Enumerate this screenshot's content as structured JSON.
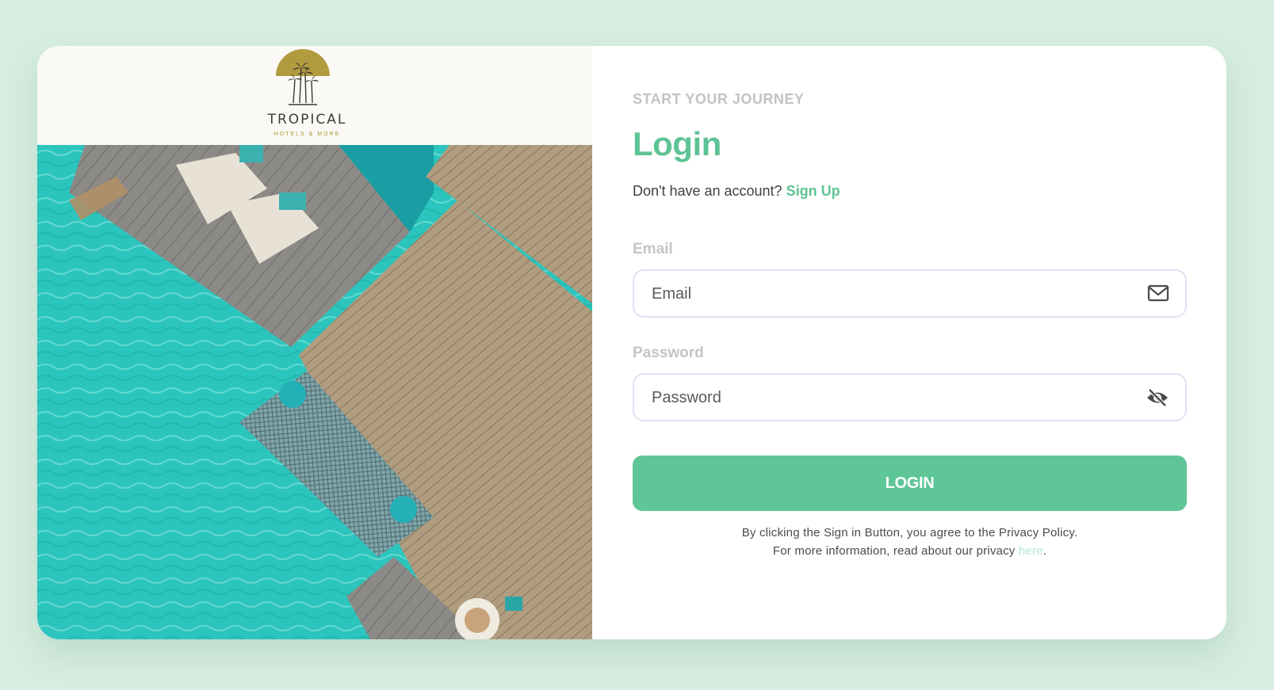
{
  "brand": {
    "name": "TROPICAL",
    "tagline": "HOTELS & MORE"
  },
  "form": {
    "eyebrow": "START YOUR JOURNEY",
    "title": "Login",
    "account_prompt": "Don't have an account?",
    "signup_link": "Sign Up",
    "email": {
      "label": "Email",
      "placeholder": "Email",
      "value": "",
      "icon": "mail-icon"
    },
    "password": {
      "label": "Password",
      "placeholder": "Password",
      "value": "",
      "icon": "eye-off-icon"
    },
    "submit_label": "LOGIN",
    "legal_line1": "By clicking the Sign in Button, you agree to the Privacy Policy.",
    "legal_line2": "For more information, read about our privacy",
    "legal_link": "here",
    "legal_end": "."
  },
  "colors": {
    "page_bg": "#d6eee1",
    "accent": "#5ec394",
    "button": "#5ec697",
    "logo_gold": "#b29a3f"
  }
}
